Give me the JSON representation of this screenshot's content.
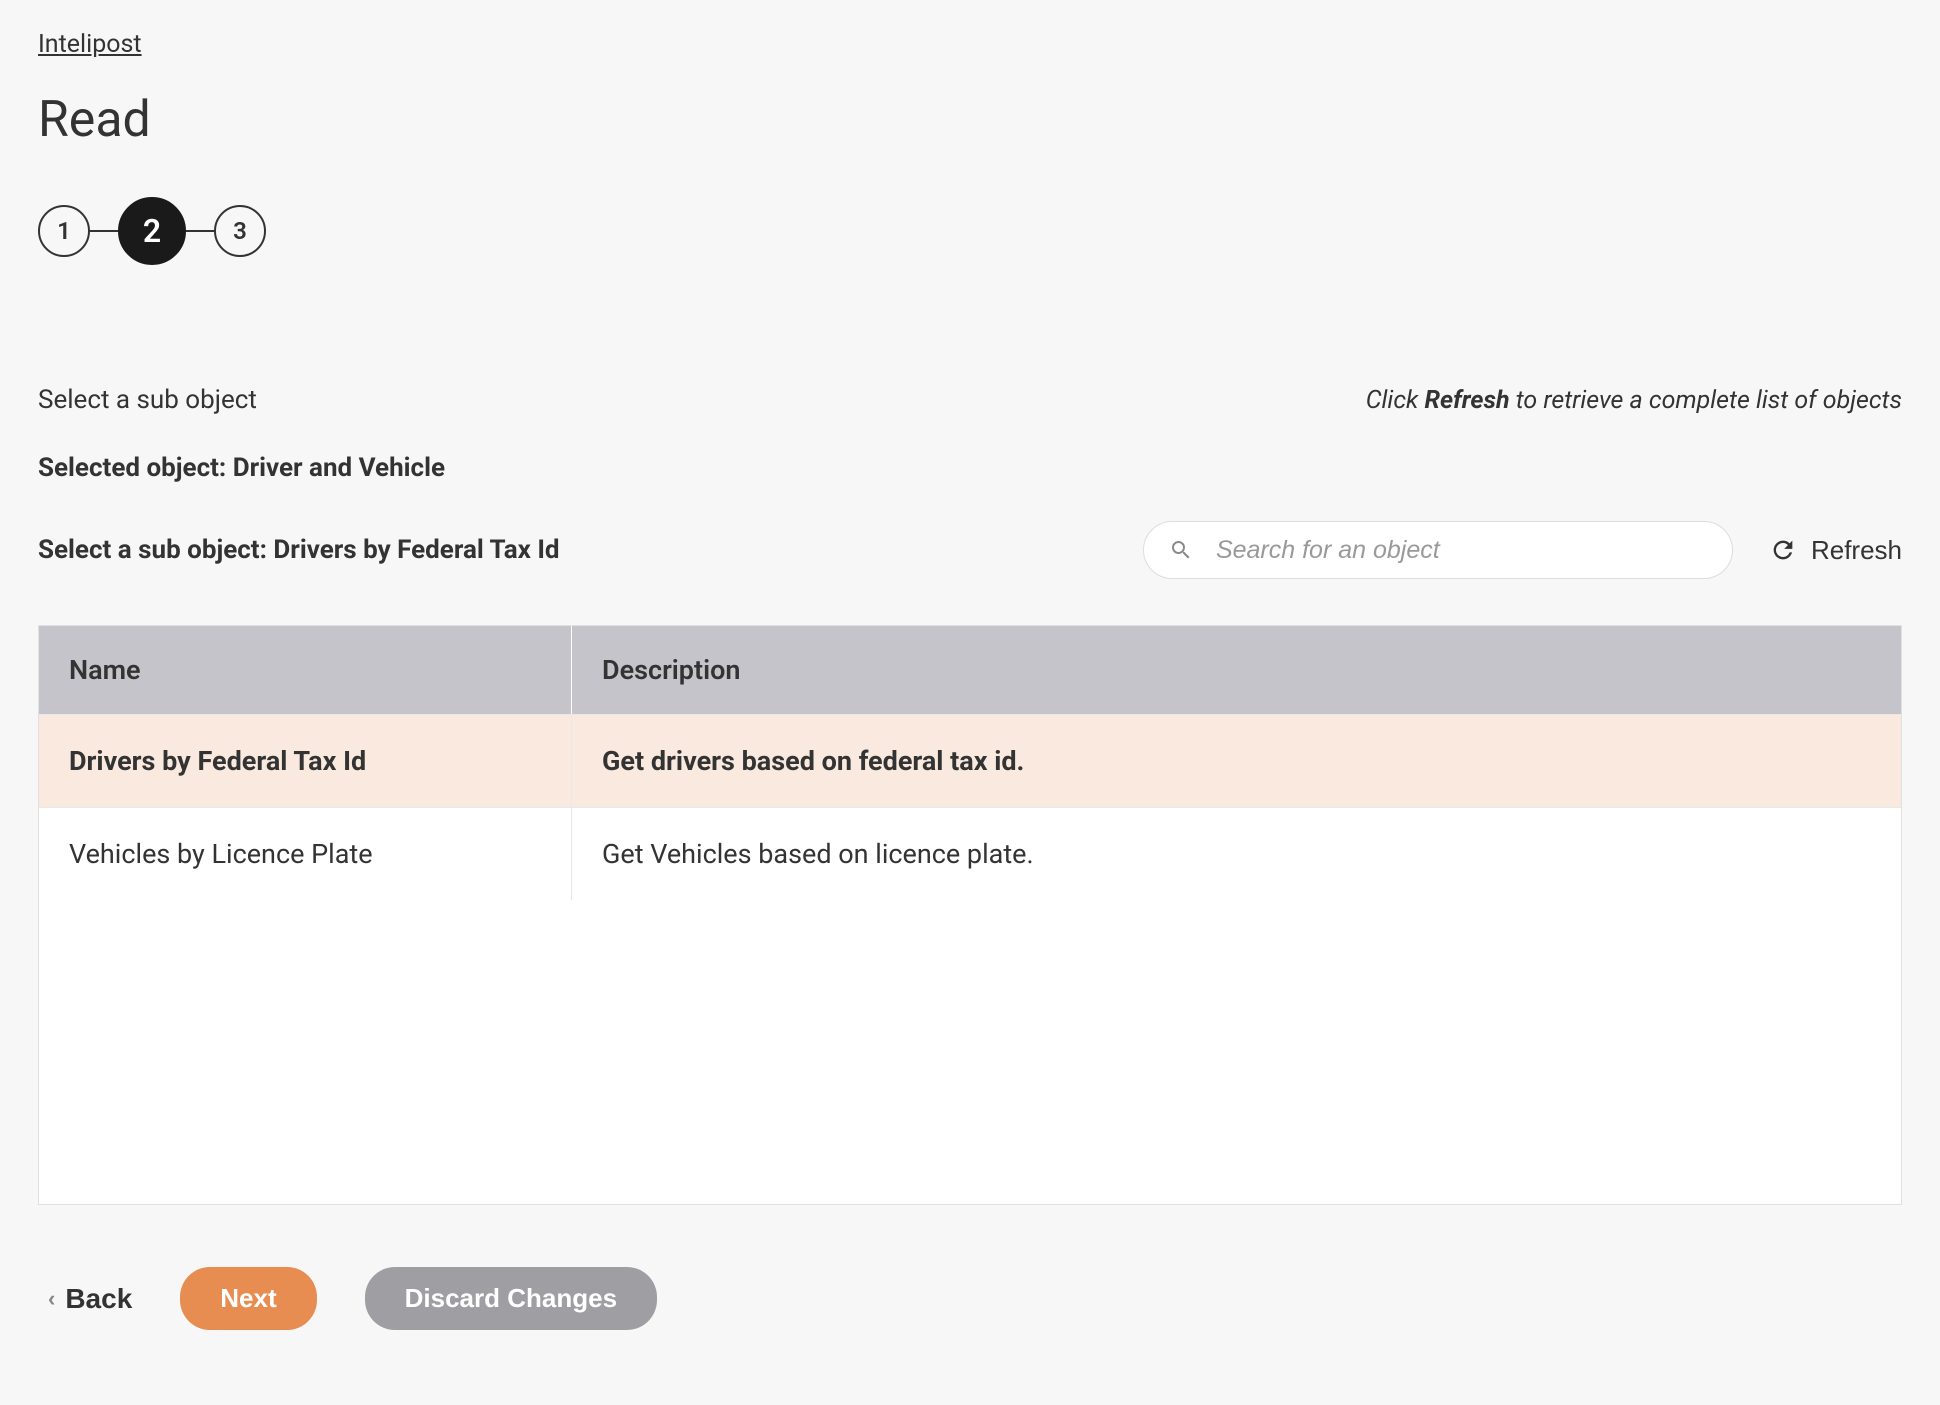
{
  "breadcrumb": {
    "link_label": "Intelipost"
  },
  "page": {
    "title": "Read"
  },
  "stepper": {
    "steps": [
      "1",
      "2",
      "3"
    ],
    "active_index": 1
  },
  "section": {
    "select_sub_object_label": "Select a sub object",
    "hint_prefix": "Click ",
    "hint_strong": "Refresh",
    "hint_suffix": " to retrieve a complete list of objects",
    "selected_object_prefix": "Selected object: ",
    "selected_object_value": "Driver and Vehicle",
    "select_sub_object_prefix": "Select a sub object: ",
    "select_sub_object_value": "Drivers by Federal Tax Id"
  },
  "search": {
    "placeholder": "Search for an object"
  },
  "refresh": {
    "label": "Refresh"
  },
  "table": {
    "headers": {
      "name": "Name",
      "description": "Description"
    },
    "rows": [
      {
        "name": "Drivers by Federal Tax Id",
        "description": "Get drivers based on federal tax id.",
        "selected": true
      },
      {
        "name": "Vehicles by Licence Plate",
        "description": "Get Vehicles based on licence plate.",
        "selected": false
      }
    ]
  },
  "footer": {
    "back_label": "Back",
    "next_label": "Next",
    "discard_label": "Discard Changes"
  }
}
